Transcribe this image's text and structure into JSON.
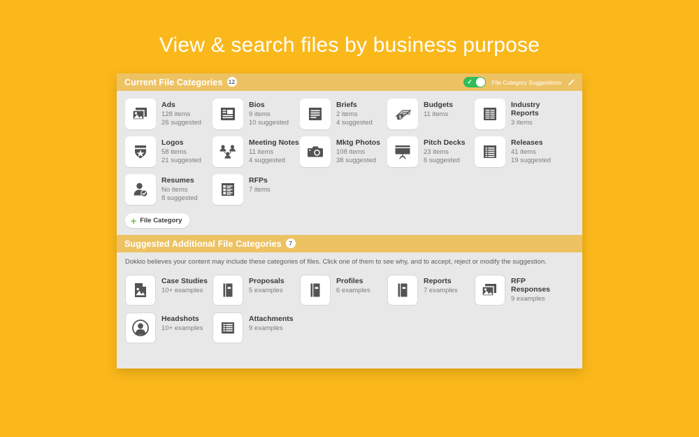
{
  "hero": {
    "title": "View & search files by business purpose"
  },
  "current_section": {
    "title": "Current File Categories",
    "count": "12",
    "toggle": {
      "state_icon": "checkmark-icon",
      "label": "File Category Suggestions",
      "on": true
    },
    "edit_icon": "pencil-icon",
    "add_button": {
      "plus_icon": "plus-icon",
      "label": "File Category"
    },
    "categories": [
      {
        "name": "Ads",
        "icon": "images-stack-icon",
        "items": "128 items",
        "suggested": "26 suggested"
      },
      {
        "name": "Bios",
        "icon": "bio-document-icon",
        "items": "9 items",
        "suggested": "10 suggested"
      },
      {
        "name": "Briefs",
        "icon": "lines-document-icon",
        "items": "2 items",
        "suggested": "4 suggested"
      },
      {
        "name": "Budgets",
        "icon": "money-stack-icon",
        "items": "11 items",
        "suggested": ""
      },
      {
        "name": "Industry Reports",
        "icon": "two-column-doc-icon",
        "items": "3 items",
        "suggested": ""
      },
      {
        "name": "Logos",
        "icon": "shield-star-icon",
        "items": "58 items",
        "suggested": "21 suggested"
      },
      {
        "name": "Meeting Notes",
        "icon": "people-group-icon",
        "items": "11 items",
        "suggested": "4 suggested"
      },
      {
        "name": "Mktg Photos",
        "icon": "camera-icon",
        "items": "108 items",
        "suggested": "38 suggested"
      },
      {
        "name": "Pitch Decks",
        "icon": "presentation-icon",
        "items": "23 items",
        "suggested": "6 suggested"
      },
      {
        "name": "Releases",
        "icon": "release-list-icon",
        "items": "41 items",
        "suggested": "19 suggested"
      },
      {
        "name": "Resumes",
        "icon": "person-check-icon",
        "items": "No items",
        "suggested": "8 suggested"
      },
      {
        "name": "RFPs",
        "icon": "checklist-icon",
        "items": "7 items",
        "suggested": ""
      }
    ]
  },
  "suggested_section": {
    "title": "Suggested Additional File Categories",
    "count": "7",
    "hint": "Dokkio believes your content may include these categories of files. Click one of them to see why, and to accept, reject or modify the suggestion.",
    "categories": [
      {
        "name": "Case Studies",
        "icon": "image-page-icon",
        "examples": "10+ examples"
      },
      {
        "name": "Proposals",
        "icon": "book-icon",
        "examples": "5 examples"
      },
      {
        "name": "Profiles",
        "icon": "book-icon",
        "examples": "6 examples"
      },
      {
        "name": "Reports",
        "icon": "book-icon",
        "examples": "7 examples"
      },
      {
        "name": "RFP Responses",
        "icon": "images-stack-icon",
        "examples": "9 examples"
      },
      {
        "name": "Headshots",
        "icon": "person-circle-icon",
        "examples": "10+ examples"
      },
      {
        "name": "Attachments",
        "icon": "attachment-list-icon",
        "examples": "9 examples"
      }
    ]
  },
  "colors": {
    "background": "#FAB81B",
    "section_bar": "#EDC263",
    "panel": "#E8E8E8",
    "toggle_on": "#2EBD59",
    "plus_green": "#6FBE44",
    "icon_gray": "#535353"
  }
}
